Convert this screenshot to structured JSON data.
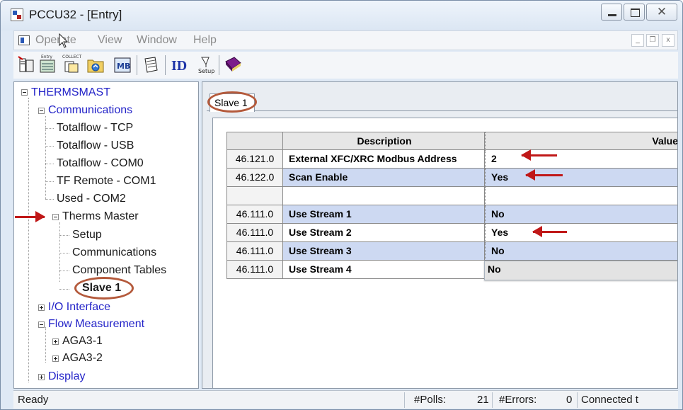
{
  "window": {
    "title": "PCCU32 - [Entry]"
  },
  "menu": {
    "items": [
      "Operate",
      "View",
      "Window",
      "Help"
    ],
    "mdi": {
      "minimize": "_",
      "restore": "❐",
      "close": "x"
    }
  },
  "toolbar": {
    "buttons": [
      {
        "name": "terminal-icon"
      },
      {
        "name": "entry-icon",
        "caption": "Entry"
      },
      {
        "name": "collect-icon",
        "caption": "COLLECT"
      },
      {
        "name": "folder-refresh-icon"
      },
      {
        "name": "modbus-icon",
        "caption": "MB"
      },
      {
        "name": "notebook-icon"
      },
      {
        "name": "id-icon",
        "caption": "ID"
      },
      {
        "name": "setup-icon",
        "caption": "Setup"
      },
      {
        "name": "help-book-icon"
      }
    ]
  },
  "tree": {
    "root": "THERMSMAST",
    "communications": "Communications",
    "comm_children": [
      "Totalflow - TCP",
      "Totalflow - USB",
      "Totalflow - COM0",
      "TF Remote - COM1",
      "Used - COM2"
    ],
    "therms_master": "Therms Master",
    "therms_children": [
      "Setup",
      "Communications",
      "Component Tables"
    ],
    "selected": "Slave 1",
    "io_interface": "I/O Interface",
    "flow_measurement": "Flow Measurement",
    "flow_children": [
      "AGA3-1",
      "AGA3-2"
    ],
    "display": "Display"
  },
  "tabs": {
    "active": "Slave 1"
  },
  "grid": {
    "headers": {
      "register": "",
      "description": "Description",
      "value": "Value"
    },
    "rows": [
      {
        "register": "46.121.0",
        "description": "External XFC/XRC Modbus Address",
        "value": "2",
        "highlight": false
      },
      {
        "register": "46.122.0",
        "description": "Scan Enable",
        "value": "Yes",
        "highlight": true
      },
      {
        "register": "",
        "description": "",
        "value": "",
        "highlight": false
      },
      {
        "register": "46.111.0",
        "description": "Use Stream 1",
        "value": "No",
        "highlight": true
      },
      {
        "register": "46.111.0",
        "description": "Use Stream 2",
        "value": "Yes",
        "highlight": false
      },
      {
        "register": "46.111.0",
        "description": "Use Stream 3",
        "value": "No",
        "highlight": true
      },
      {
        "register": "46.111.0",
        "description": "Use Stream 4",
        "value": "No",
        "highlight": false,
        "editing": true
      }
    ]
  },
  "status": {
    "state": "Ready",
    "polls_label": "#Polls:",
    "polls_value": "21",
    "errors_label": "#Errors:",
    "errors_value": "0",
    "connection": "Connected t"
  },
  "colors": {
    "annotation_arrow": "#c01818",
    "annotation_circle": "#b45a3c",
    "row_highlight": "#cdd9f2"
  }
}
